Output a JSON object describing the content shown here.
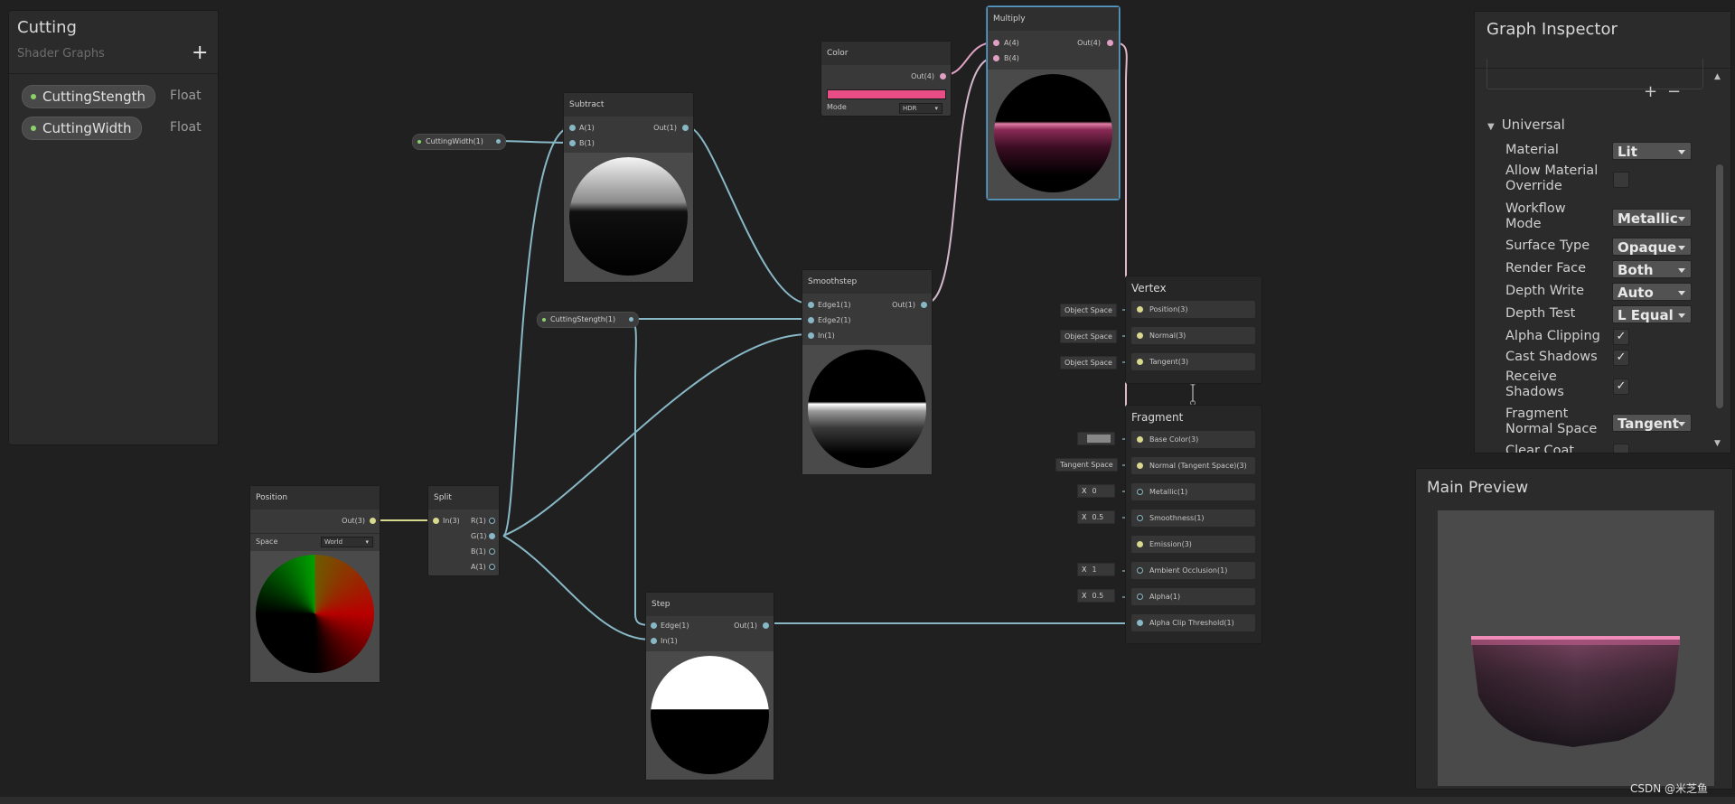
{
  "blackboard": {
    "title": "Cutting",
    "subtitle": "Shader Graphs",
    "add_icon": "+",
    "properties": [
      {
        "name": "CuttingStength",
        "type": "Float"
      },
      {
        "name": "CuttingWidth",
        "type": "Float"
      }
    ]
  },
  "nodes": {
    "position": {
      "title": "Position",
      "out": "Out(3)",
      "space_label": "Space",
      "space_value": "World"
    },
    "split": {
      "title": "Split",
      "in": "In(3)",
      "outs": [
        "R(1)",
        "G(1)",
        "B(1)",
        "A(1)"
      ]
    },
    "subtract": {
      "title": "Subtract",
      "a": "A(1)",
      "b": "B(1)",
      "out": "Out(1)"
    },
    "color": {
      "title": "Color",
      "out": "Out(4)",
      "mode_label": "Mode",
      "mode_value": "HDR",
      "swatch": "#e94d86"
    },
    "multiply": {
      "title": "Multiply",
      "a": "A(4)",
      "b": "B(4)",
      "out": "Out(4)"
    },
    "smoothstep": {
      "title": "Smoothstep",
      "edge1": "Edge1(1)",
      "edge2": "Edge2(1)",
      "in": "In(1)",
      "out": "Out(1)"
    },
    "step": {
      "title": "Step",
      "edge": "Edge(1)",
      "in": "In(1)",
      "out": "Out(1)"
    }
  },
  "property_nodes": {
    "cutting_width": "CuttingWidth(1)",
    "cutting_strength": "CuttingStength(1)"
  },
  "master": {
    "vertex": {
      "title": "Vertex",
      "slots": [
        "Position(3)",
        "Normal(3)",
        "Tangent(3)"
      ],
      "inputs": [
        "Object Space",
        "Object Space",
        "Object Space"
      ]
    },
    "fragment": {
      "title": "Fragment",
      "slots": [
        "Base Color(3)",
        "Normal (Tangent Space)(3)",
        "Metallic(1)",
        "Smoothness(1)",
        "Emission(3)",
        "Ambient Occlusion(1)",
        "Alpha(1)",
        "Alpha Clip Threshold(1)"
      ],
      "normal_input": "Tangent Space",
      "x_label": "X",
      "metallic": "0",
      "smoothness": "0.5",
      "occlusion": "1",
      "alpha": "0.5"
    }
  },
  "inspector": {
    "title": "Graph Inspector",
    "plus": "+",
    "minus": "−",
    "section": "Universal",
    "rows": [
      {
        "label": "Material",
        "value": "Lit",
        "kind": "dropdown"
      },
      {
        "label": "Allow Material Override",
        "value": "",
        "kind": "check"
      },
      {
        "label": "Workflow Mode",
        "value": "Metallic",
        "kind": "dropdown"
      },
      {
        "label": "Surface Type",
        "value": "Opaque",
        "kind": "dropdown"
      },
      {
        "label": "Render Face",
        "value": "Both",
        "kind": "dropdown"
      },
      {
        "label": "Depth Write",
        "value": "Auto",
        "kind": "dropdown"
      },
      {
        "label": "Depth Test",
        "value": "L Equal",
        "kind": "dropdown"
      },
      {
        "label": "Alpha Clipping",
        "value": "✓",
        "kind": "check"
      },
      {
        "label": "Cast Shadows",
        "value": "✓",
        "kind": "check"
      },
      {
        "label": "Receive Shadows",
        "value": "✓",
        "kind": "check"
      },
      {
        "label": "Fragment Normal Space",
        "value": "Tangent",
        "kind": "dropdown"
      },
      {
        "label": "Clear Coat",
        "value": "",
        "kind": "check"
      }
    ]
  },
  "preview": {
    "title": "Main Preview"
  },
  "watermark": "CSDN @米芝鱼",
  "colors": {
    "background": "#202020",
    "wire": "#88b8c6",
    "vector_wire": "#d8d88e",
    "color_wire": "#e0a0c4",
    "accent_pink": "#e94d86"
  }
}
